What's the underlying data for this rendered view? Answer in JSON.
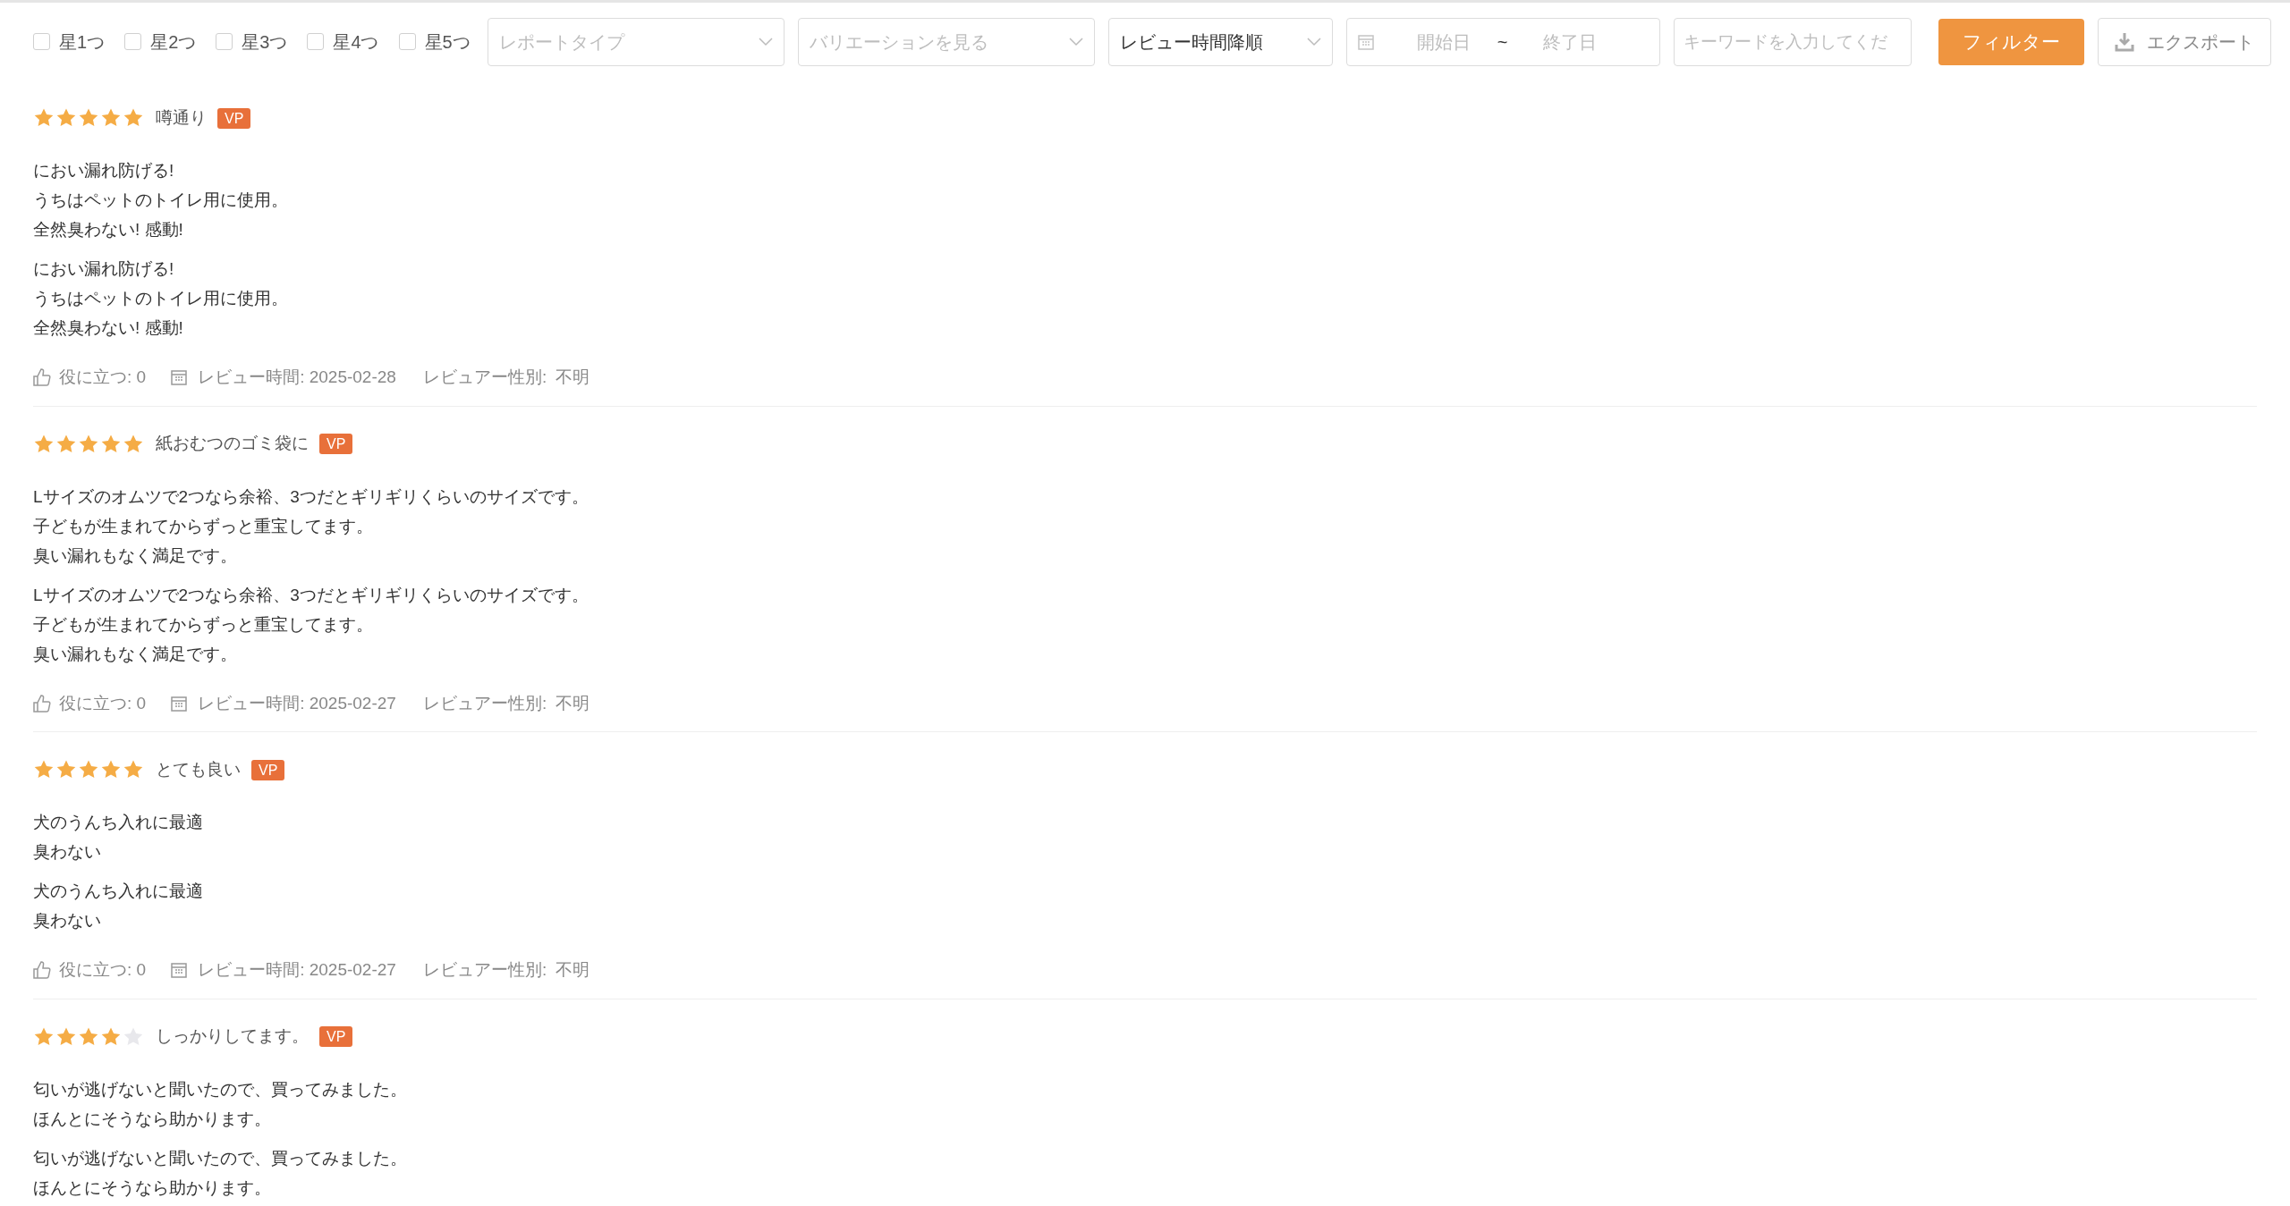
{
  "filters": {
    "star_checkboxes": [
      {
        "label": "星1つ",
        "checked": false
      },
      {
        "label": "星2つ",
        "checked": false
      },
      {
        "label": "星3つ",
        "checked": false
      },
      {
        "label": "星4つ",
        "checked": false
      },
      {
        "label": "星5つ",
        "checked": false
      }
    ],
    "selects": [
      {
        "placeholder": "レポートタイプ"
      },
      {
        "placeholder": "バリエーションを見る"
      },
      {
        "value": "レビュー時間降順"
      }
    ],
    "date_range": {
      "start_placeholder": "開始日",
      "separator": "~",
      "end_placeholder": "終了日"
    },
    "keyword": {
      "placeholder": "キーワードを入力してくだ"
    },
    "filter_button": "フィルター",
    "export_button": "エクスポート"
  },
  "reviews": [
    {
      "stars": 5,
      "title": "噂通り",
      "badge": "VP",
      "paragraphs": [
        [
          "におい漏れ防げる!",
          "うちはペットのトイレ用に使用。",
          "全然臭わない!  感動!"
        ],
        [
          "におい漏れ防げる!",
          "うちはペットのトイレ用に使用。",
          "全然臭わない!  感動!"
        ]
      ],
      "footer": {
        "helpful": "役に立つ: 0",
        "review_time": "レビュー時間: 2025-02-28",
        "gender_label": "レビュアー性別:",
        "gender_value": "不明"
      }
    },
    {
      "stars": 5,
      "title": "紙おむつのゴミ袋に",
      "badge": "VP",
      "paragraphs": [
        [
          "Lサイズのオムツで2つなら余裕、3つだとギリギリくらいのサイズです。",
          "子どもが生まれてからずっと重宝してます。",
          "臭い漏れもなく満足です。"
        ],
        [
          "Lサイズのオムツで2つなら余裕、3つだとギリギリくらいのサイズです。",
          "子どもが生まれてからずっと重宝してます。",
          "臭い漏れもなく満足です。"
        ]
      ],
      "footer": {
        "helpful": "役に立つ: 0",
        "review_time": "レビュー時間: 2025-02-27",
        "gender_label": "レビュアー性別:",
        "gender_value": "不明"
      }
    },
    {
      "stars": 5,
      "title": "とても良い",
      "badge": "VP",
      "paragraphs": [
        [
          "犬のうんち入れに最適",
          "臭わない"
        ],
        [
          "犬のうんち入れに最適",
          "臭わない"
        ]
      ],
      "footer": {
        "helpful": "役に立つ: 0",
        "review_time": "レビュー時間: 2025-02-27",
        "gender_label": "レビュアー性別:",
        "gender_value": "不明"
      }
    },
    {
      "stars": 4,
      "title": "しっかりしてます。",
      "badge": "VP",
      "paragraphs": [
        [
          "匂いが逃げないと聞いたので、買ってみました。",
          "ほんとにそうなら助かります。"
        ],
        [
          "匂いが逃げないと聞いたので、買ってみました。",
          "ほんとにそうなら助かります。"
        ]
      ]
    }
  ]
}
